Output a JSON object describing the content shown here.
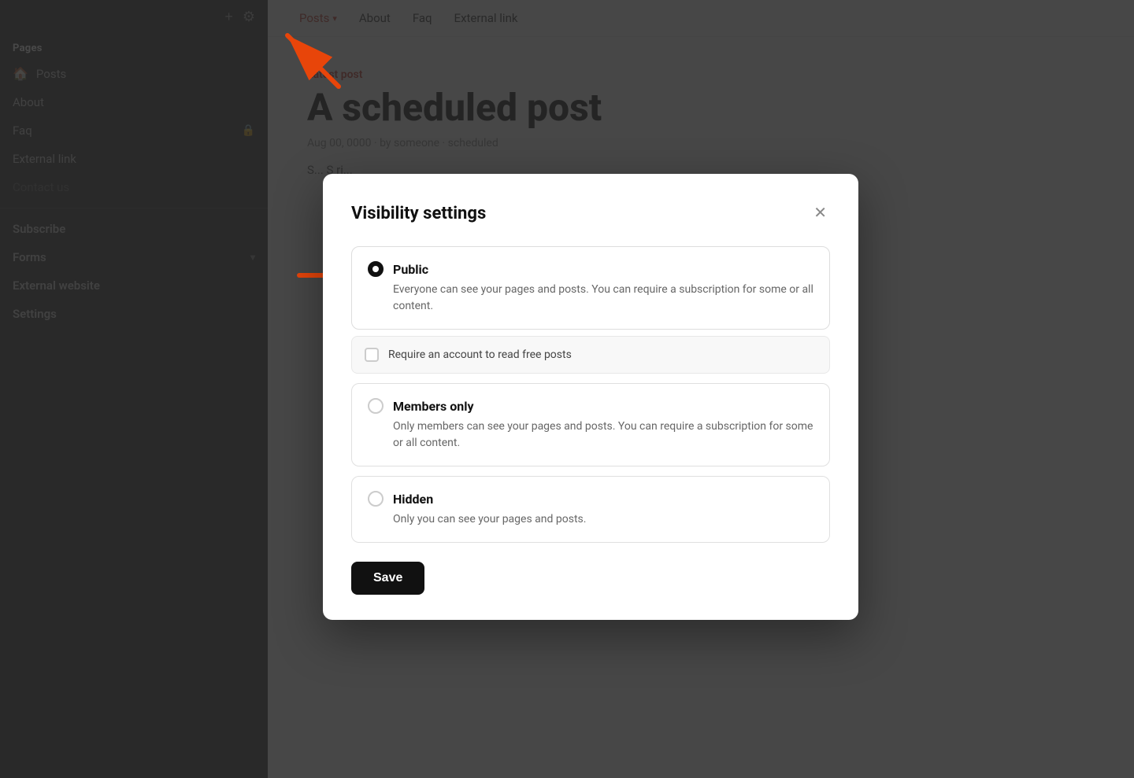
{
  "sidebar": {
    "pages_label": "Pages",
    "subscribe_label": "Subscribe",
    "forms_label": "Forms",
    "external_website_label": "External website",
    "settings_label": "Settings",
    "nav_items": [
      {
        "label": "Posts",
        "icon": "🏠",
        "hasIcon": true
      },
      {
        "label": "About",
        "hasIcon": false
      },
      {
        "label": "Faq",
        "hasIcon": false,
        "hasLock": true
      },
      {
        "label": "External link",
        "hasIcon": false
      },
      {
        "label": "Contact us",
        "hasIcon": false,
        "dimmed": true
      }
    ]
  },
  "main_nav": {
    "items": [
      {
        "label": "Posts",
        "active": true
      },
      {
        "label": "About"
      },
      {
        "label": "Faq"
      },
      {
        "label": "External link"
      }
    ]
  },
  "main_content": {
    "latest_post_label": "Latest post",
    "post_title": "A scheduled post",
    "post_meta": "Aug 00, 0000 · by someone · scheduled",
    "post_excerpt": "S... S ri..."
  },
  "modal": {
    "title": "Visibility settings",
    "close_label": "×",
    "options": [
      {
        "id": "public",
        "label": "Public",
        "description": "Everyone can see your pages and posts. You can require a subscription for some or all content.",
        "selected": true
      },
      {
        "id": "members",
        "label": "Members only",
        "description": "Only members can see your pages and posts. You can require a subscription for some or all content.",
        "selected": false
      },
      {
        "id": "hidden",
        "label": "Hidden",
        "description": "Only you can see your pages and posts.",
        "selected": false
      }
    ],
    "sub_option_label": "Require an account to read free posts",
    "save_button_label": "Save"
  }
}
